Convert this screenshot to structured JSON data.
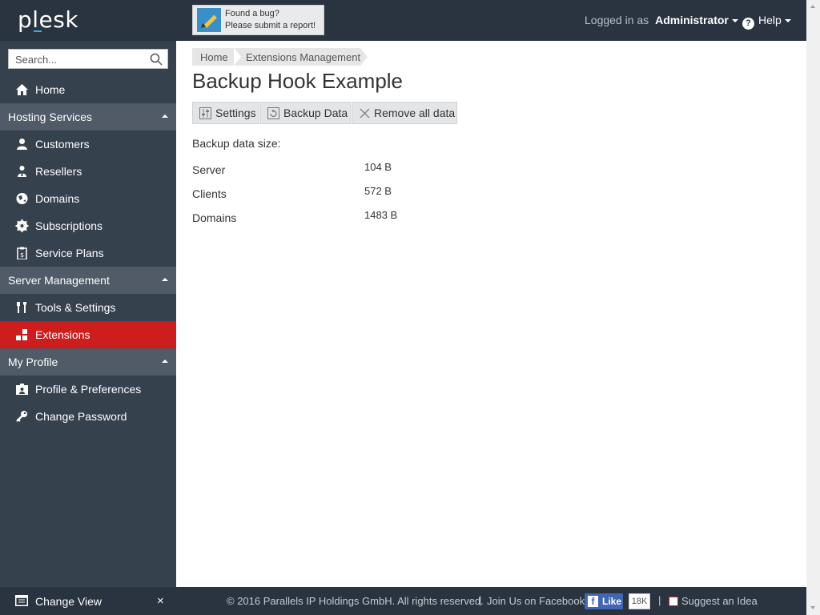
{
  "header": {
    "logo": "plesk",
    "bug_line1": "Found a bug?",
    "bug_line2": "Please submit a report!",
    "logged_in_prefix": "Logged in as",
    "user": "Administrator",
    "help": "Help"
  },
  "sidebar": {
    "search_placeholder": "Search...",
    "home": "Home",
    "groups": {
      "hosting": "Hosting Services",
      "server": "Server Management",
      "profile": "My Profile"
    },
    "items": {
      "customers": "Customers",
      "resellers": "Resellers",
      "domains": "Domains",
      "subscriptions": "Subscriptions",
      "service_plans": "Service Plans",
      "tools": "Tools & Settings",
      "extensions": "Extensions",
      "profile_prefs": "Profile & Preferences",
      "change_password": "Change Password"
    },
    "change_view": "Change View"
  },
  "breadcrumb": [
    "Home",
    "Extensions Management"
  ],
  "page_title": "Backup Hook Example",
  "toolbar": {
    "settings": "Settings",
    "backup_data": "Backup Data",
    "remove_all": "Remove all data"
  },
  "backup": {
    "heading": "Backup data size:",
    "rows": [
      {
        "label": "Server",
        "value": "104 B"
      },
      {
        "label": "Clients",
        "value": "572 B"
      },
      {
        "label": "Domains",
        "value": "1483 B"
      }
    ]
  },
  "footer": {
    "copyright": "© 2016 Parallels IP Holdings GmbH. All rights reserved.",
    "join": "Join Us on Facebook",
    "like": "Like",
    "like_count": "18K",
    "suggest": "Suggest an Idea"
  },
  "colors": {
    "header_bg": "#2a3340",
    "sidebar_bg": "#36414e",
    "group_bg": "#505b67",
    "active": "#cd1d1d",
    "accent": "#2cb1e5"
  }
}
